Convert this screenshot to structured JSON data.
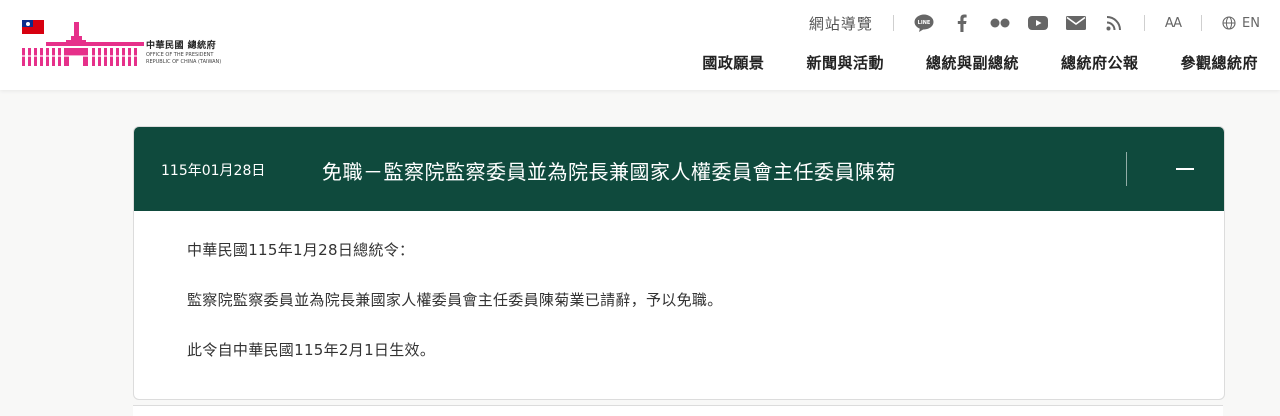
{
  "header": {
    "logo": {
      "zh": "中華民國 總統府",
      "en_line1": "OFFICE OF THE PRESIDENT",
      "en_line2": "REPUBLIC OF CHINA (TAIWAN)"
    },
    "utility": {
      "sitemap": "網站導覽",
      "social_icons": [
        "line-icon",
        "facebook-icon",
        "flickr-icon",
        "youtube-icon",
        "mail-icon",
        "rss-icon"
      ],
      "line_label": "LINE",
      "font_size_label": "AA",
      "language": "EN"
    },
    "nav": [
      {
        "label": "國政願景"
      },
      {
        "label": "新聞與活動"
      },
      {
        "label": "總統與副總統"
      },
      {
        "label": "總統府公報"
      },
      {
        "label": "參觀總統府"
      }
    ]
  },
  "article": {
    "date": "115年01月28日",
    "title": "免職－監察院監察委員並為院長兼國家人權委員會主任委員陳菊",
    "paragraphs": [
      "中華民國115年1月28日總統令：",
      "監察院監察委員並為院長兼國家人權委員會主任委員陳菊業已請辭，予以免職。",
      "此令自中華民國115年2月1日生效。"
    ],
    "toggle_icon": "minus-icon"
  },
  "colors": {
    "header_bg": "#ffffff",
    "page_bg": "#f8f8f7",
    "card_header_bg": "#0f4a3d",
    "logo_pink": "#e6308a",
    "flag_red": "#d7000f",
    "flag_blue": "#0b2d8c"
  }
}
